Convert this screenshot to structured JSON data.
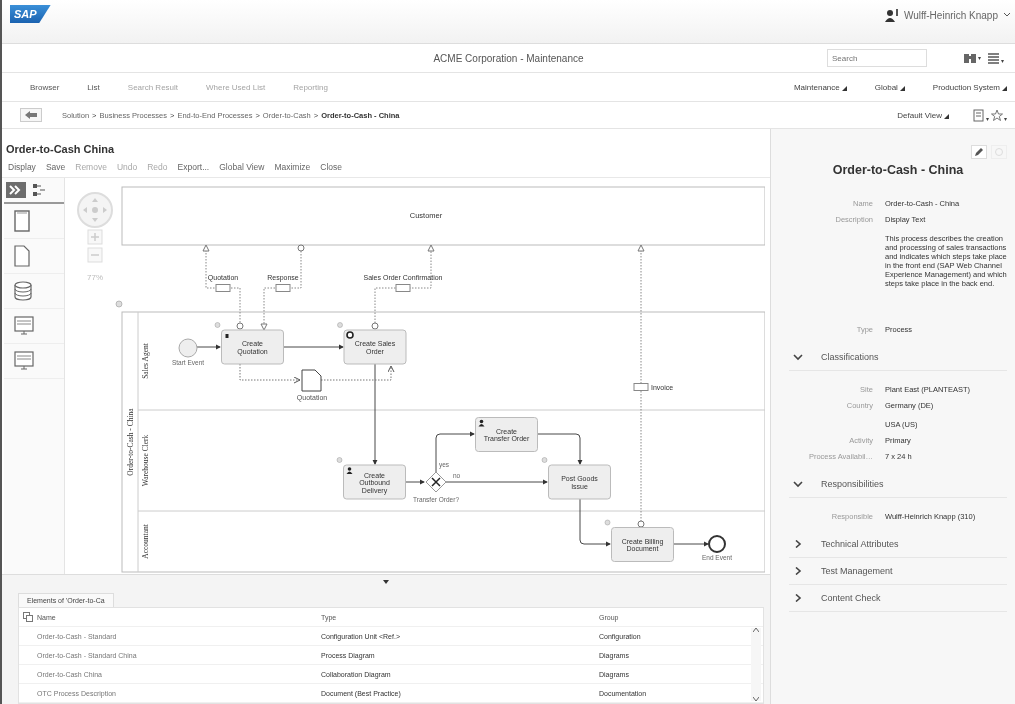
{
  "header": {
    "logo": "SAP",
    "user": "Wulff-Heinrich Knapp"
  },
  "title_bar": {
    "title": "ACME Corporation - Maintenance",
    "search": {
      "placeholder": "Search"
    }
  },
  "nav_tabs": [
    {
      "label": "Browser",
      "disabled": false
    },
    {
      "label": "List",
      "disabled": false
    },
    {
      "label": "Search Result",
      "disabled": true
    },
    {
      "label": "Where Used List",
      "disabled": true
    },
    {
      "label": "Reporting",
      "disabled": true
    }
  ],
  "nav_menus": [
    "Maintenance",
    "Global",
    "Production System"
  ],
  "breadcrumb": {
    "separator": ">",
    "items": [
      {
        "label": "Solution",
        "current": false
      },
      {
        "label": "Business Processes",
        "current": false
      },
      {
        "label": "End-to-End Processes",
        "current": false
      },
      {
        "label": "Order-to-Cash",
        "current": false
      },
      {
        "label": "Order-to-Cash - China",
        "current": true
      }
    ],
    "view": "Default View"
  },
  "editor": {
    "title": "Order-to-Cash China",
    "toolbar": [
      {
        "label": "Display",
        "disabled": false
      },
      {
        "label": "Save",
        "disabled": false
      },
      {
        "label": "Remove",
        "disabled": true
      },
      {
        "label": "Undo",
        "disabled": true
      },
      {
        "label": "Redo",
        "disabled": true
      },
      {
        "label": "Export...",
        "disabled": false
      },
      {
        "label": "Global View",
        "disabled": false
      },
      {
        "label": "Maximize",
        "disabled": false
      },
      {
        "label": "Close",
        "disabled": false
      }
    ],
    "zoom": "77%",
    "diagram": {
      "customer_pool": "Customer",
      "pool": "Order-to-Cash - China",
      "lanes": [
        "Sales Agent",
        "Warehouse Clerk",
        "Accountant"
      ],
      "events": [
        {
          "kind": "start",
          "label": "Start Event"
        },
        {
          "kind": "end",
          "label": "End Event"
        }
      ],
      "tasks": [
        {
          "label": "Create Quotation",
          "kind": "manual"
        },
        {
          "label": "Create Sales Order",
          "kind": "service"
        },
        {
          "label": "Create Outbound Delivery",
          "kind": "user"
        },
        {
          "label": "Create Transfer Order",
          "kind": "user"
        },
        {
          "label": "Post Goods Issue",
          "kind": "plain"
        },
        {
          "label": "Create Billing Document",
          "kind": "plain"
        }
      ],
      "gateway": {
        "label": "Transfer Order?",
        "yes": "yes",
        "no": "no"
      },
      "data_object": "Quotation",
      "messages": [
        "Quotation",
        "Response",
        "Sales Order Confirmation",
        "Invoice"
      ]
    }
  },
  "elements": {
    "tab": "Elements of 'Order-to-Ca",
    "columns": [
      "Name",
      "Type",
      "Group"
    ],
    "rows": [
      [
        "Order-to-Cash - Standard",
        "Configuration Unit <Ref.>",
        "Configuration"
      ],
      [
        "Order-to-Cash - Standard China",
        "Process Diagram",
        "Diagrams"
      ],
      [
        "Order-to-Cash China",
        "Collaboration Diagram",
        "Diagrams"
      ],
      [
        "OTC Process Description",
        "Document (Best Practice)",
        "Documentation"
      ]
    ]
  },
  "details": {
    "title": "Order-to-Cash - China",
    "fields": [
      {
        "label": "Name",
        "values": [
          "Order-to-Cash - China"
        ]
      },
      {
        "label": "Description",
        "values": [
          "Display Text",
          "This process describes the creation and processing of sales transactions and indicates which steps take place in the front end (SAP Web Channel Experience Management) and which steps take place in the back end."
        ]
      },
      {
        "label": "Type",
        "values": [
          "Process"
        ]
      }
    ],
    "sections": [
      {
        "title": "Classifications",
        "expanded": true,
        "fields": [
          {
            "label": "Site",
            "values": [
              "Plant East (PLANTEAST)"
            ]
          },
          {
            "label": "Country",
            "values": [
              "Germany (DE)",
              "USA (US)"
            ]
          },
          {
            "label": "Activity",
            "values": [
              "Primary"
            ]
          },
          {
            "label": "Process Availabil…",
            "values": [
              "7 x 24 h"
            ]
          }
        ]
      },
      {
        "title": "Responsibilities",
        "expanded": true,
        "fields": [
          {
            "label": "Responsible",
            "values": [
              "Wulff-Heinrich Knapp (310)"
            ]
          }
        ]
      },
      {
        "title": "Technical Attributes",
        "expanded": false
      },
      {
        "title": "Test Management",
        "expanded": false
      },
      {
        "title": "Content Check",
        "expanded": false
      }
    ]
  }
}
